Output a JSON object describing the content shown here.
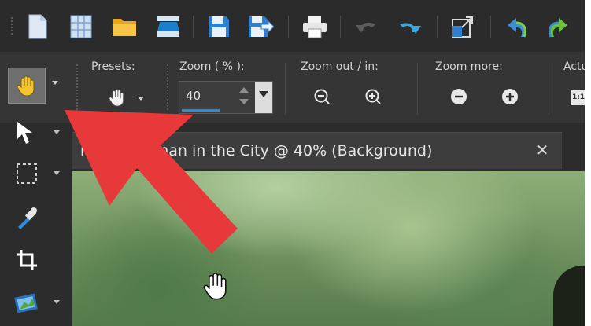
{
  "colors": {
    "toolbar_bg": "#2b2b2b",
    "options_bg": "#353535",
    "accent_blue": "#2a8ae0",
    "annotation_red": "#e8393a",
    "active_tool_bg": "#6e6e6e"
  },
  "toolbar": {
    "buttons": [
      {
        "name": "new-file-icon"
      },
      {
        "name": "new-grid-icon"
      },
      {
        "name": "open-folder-icon"
      },
      {
        "name": "scan-icon"
      },
      {
        "name": "save-icon"
      },
      {
        "name": "save-as-icon"
      },
      {
        "name": "print-icon"
      },
      {
        "name": "undo-icon"
      },
      {
        "name": "redo-icon"
      },
      {
        "name": "resize-icon"
      },
      {
        "name": "rotate-left-icon"
      },
      {
        "name": "rotate-right-icon"
      }
    ]
  },
  "options": {
    "presets_label": "Presets:",
    "zoom_label": "Zoom ( % ):",
    "zoom_value": "40",
    "zoom_out_in_label": "Zoom out / in:",
    "zoom_more_label": "Zoom more:",
    "actual_label": "Actu",
    "actual_button_text": "1:1"
  },
  "tools": [
    {
      "name": "pan-tool",
      "icon": "hand-icon",
      "active": true
    },
    {
      "name": "pick-tool",
      "icon": "arrow-pointer-icon"
    },
    {
      "name": "selection-tool",
      "icon": "marquee-icon"
    },
    {
      "name": "dropper-tool",
      "icon": "eyedropper-icon"
    },
    {
      "name": "crop-tool",
      "icon": "crop-icon"
    },
    {
      "name": "image-tool",
      "icon": "picture-icon"
    }
  ],
  "document": {
    "tab_title": "miling Woman in the City @  40% (Background)",
    "close_glyph": "✕"
  }
}
